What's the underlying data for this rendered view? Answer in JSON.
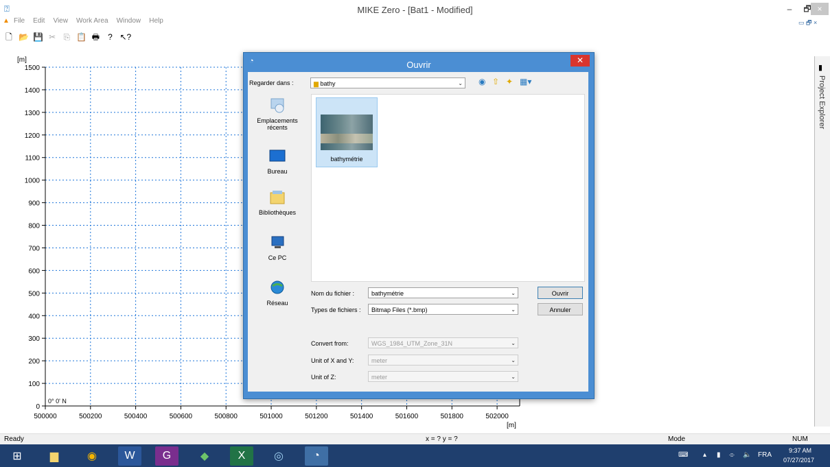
{
  "window": {
    "title": "MIKE Zero - [Bat1 - Modified]",
    "controls": {
      "minimize": "–",
      "maximize": "🗗",
      "close": "×"
    }
  },
  "menu": [
    "File",
    "Edit",
    "View",
    "Work Area",
    "Window",
    "Help"
  ],
  "chart_data": {
    "type": "scatter",
    "title": "",
    "ylabel": "[m]",
    "xlabel": "[m]",
    "x_ticks": [
      "500000",
      "500200",
      "500400",
      "500600",
      "500800",
      "501000",
      "501200",
      "501400",
      "501600",
      "501800",
      "502000"
    ],
    "y_ticks": [
      "0",
      "100",
      "200",
      "300",
      "400",
      "500",
      "600",
      "700",
      "800",
      "900",
      "1000",
      "1100",
      "1200",
      "1300",
      "1400",
      "1500"
    ],
    "xlim": [
      500000,
      502100
    ],
    "ylim": [
      0,
      1500
    ],
    "grid": true,
    "annotation": "0° 0' N",
    "series": []
  },
  "sidebar": {
    "label": "Project Explorer"
  },
  "status": {
    "left": "Ready",
    "coords": "x = ?  y = ?",
    "mode": "Mode",
    "num": "NUM"
  },
  "dialog": {
    "title": "Ouvrir",
    "look_in_label": "Regarder dans :",
    "look_in_value": "bathy",
    "places": [
      {
        "label": "Emplacements récents",
        "icon": "recent-places-icon"
      },
      {
        "label": "Bureau",
        "icon": "desktop-icon"
      },
      {
        "label": "Bibliothèques",
        "icon": "libraries-icon"
      },
      {
        "label": "Ce PC",
        "icon": "this-pc-icon"
      },
      {
        "label": "Réseau",
        "icon": "network-icon"
      }
    ],
    "files": [
      {
        "name": "bathymétrie"
      }
    ],
    "filename_label": "Nom du fichier :",
    "filename_value": "bathymétrie",
    "filetype_label": "Types de fichiers :",
    "filetype_value": "Bitmap Files (*.bmp)",
    "open_button": "Ouvrir",
    "cancel_button": "Annuler",
    "convert_label": "Convert from:",
    "convert_value": "WGS_1984_UTM_Zone_31N",
    "unit_xy_label": "Unit of X and Y:",
    "unit_xy_value": "meter",
    "unit_z_label": "Unit of Z:",
    "unit_z_value": "meter"
  },
  "taskbar": {
    "time": "9:37 AM",
    "date": "07/27/2017",
    "lang": "FRA"
  },
  "colors": {
    "grid": "#1a73d9",
    "dialog_frame": "#4b8ed3",
    "taskbar": "#1f3f6e",
    "close": "#d9352d"
  }
}
